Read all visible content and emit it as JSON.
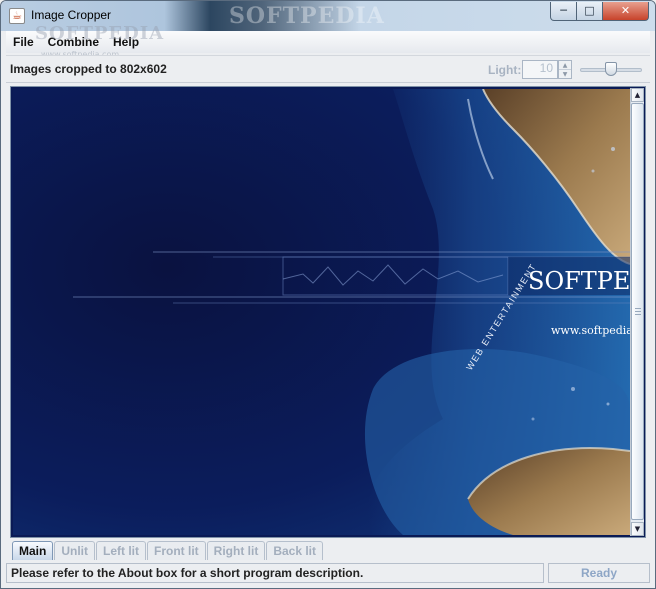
{
  "window": {
    "title": "Image Cropper",
    "title_bg_text": "SOFTPEDIA",
    "minimize_icon": "minimize-icon",
    "maximize_icon": "maximize-icon",
    "close_icon": "close-icon"
  },
  "watermark": {
    "brand": "SOFTPEDIA",
    "url": "www.softpedia.com"
  },
  "menu": {
    "items": [
      {
        "label": "File"
      },
      {
        "label": "Combine"
      },
      {
        "label": "Help"
      }
    ]
  },
  "toolbar": {
    "message": "Images cropped to 802x602",
    "light_label": "Light:",
    "light_value": "10",
    "slider_fraction": 0.5
  },
  "image": {
    "brand_text": "SOFTPEDI",
    "curve_text": "WEB ENTERTAINMENT",
    "url_text": "www.softpedia.c"
  },
  "tabs": [
    {
      "label": "Main",
      "active": true
    },
    {
      "label": "Unlit",
      "active": false
    },
    {
      "label": "Left lit",
      "active": false
    },
    {
      "label": "Front lit",
      "active": false
    },
    {
      "label": "Right lit",
      "active": false
    },
    {
      "label": "Back lit",
      "active": false
    }
  ],
  "statusbar": {
    "left": "Please refer to the About box for a short program description.",
    "right": "Ready"
  },
  "colors": {
    "deep_sea": "#0a1a55",
    "shallow_water": "#2f6fb0",
    "island": "#9b7a4e"
  }
}
